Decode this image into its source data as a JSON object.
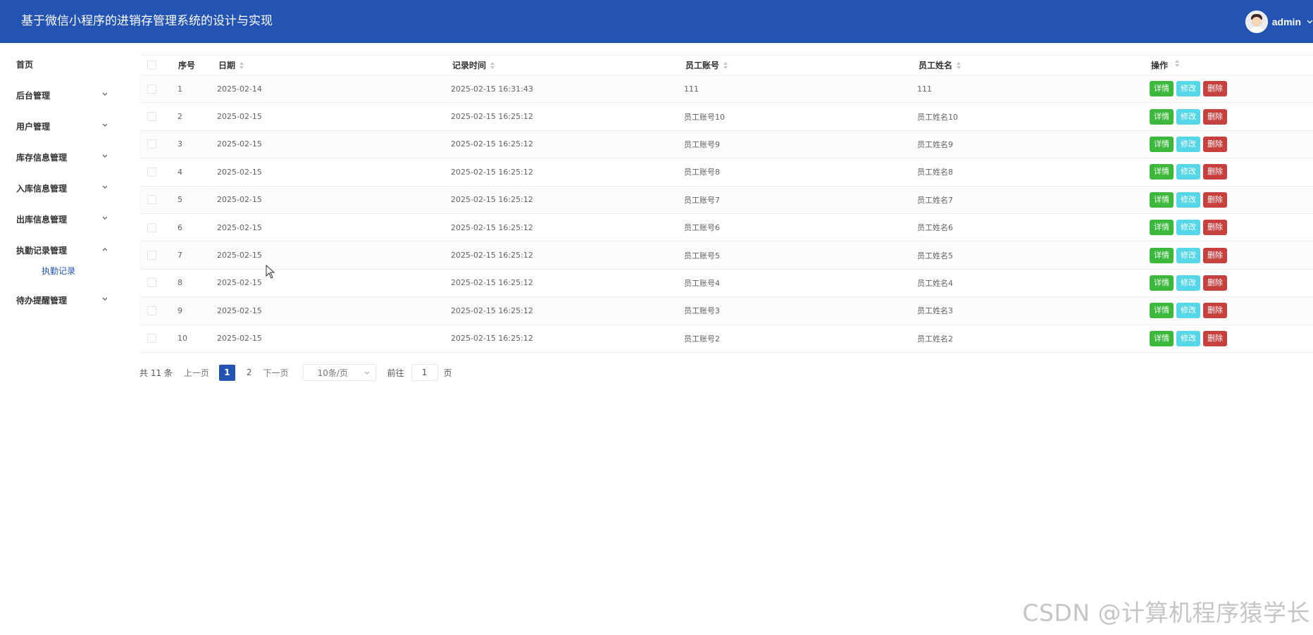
{
  "header": {
    "title": "基于微信小程序的进销存管理系统的设计与实现",
    "user": "admin",
    "accent": "#2354b4"
  },
  "sidebar": {
    "items": [
      {
        "label": "首页",
        "expandable": false
      },
      {
        "label": "后台管理",
        "expandable": true,
        "expanded": false
      },
      {
        "label": "用户管理",
        "expandable": true,
        "expanded": false
      },
      {
        "label": "库存信息管理",
        "expandable": true,
        "expanded": false
      },
      {
        "label": "入库信息管理",
        "expandable": true,
        "expanded": false
      },
      {
        "label": "出库信息管理",
        "expandable": true,
        "expanded": false
      },
      {
        "label": "执勤记录管理",
        "expandable": true,
        "expanded": true
      },
      {
        "label": "待办提醒管理",
        "expandable": true,
        "expanded": false
      }
    ],
    "active_sub": "执勤记录"
  },
  "table": {
    "headers": [
      "序号",
      "日期",
      "记录时间",
      "员工账号",
      "员工姓名",
      "操作"
    ],
    "rows": [
      {
        "idx": "1",
        "date": "2025-02-14",
        "time": "2025-02-15 16:31:43",
        "account": "111",
        "name": "111"
      },
      {
        "idx": "2",
        "date": "2025-02-15",
        "time": "2025-02-15 16:25:12",
        "account": "员工账号10",
        "name": "员工姓名10"
      },
      {
        "idx": "3",
        "date": "2025-02-15",
        "time": "2025-02-15 16:25:12",
        "account": "员工账号9",
        "name": "员工姓名9"
      },
      {
        "idx": "4",
        "date": "2025-02-15",
        "time": "2025-02-15 16:25:12",
        "account": "员工账号8",
        "name": "员工姓名8"
      },
      {
        "idx": "5",
        "date": "2025-02-15",
        "time": "2025-02-15 16:25:12",
        "account": "员工账号7",
        "name": "员工姓名7"
      },
      {
        "idx": "6",
        "date": "2025-02-15",
        "time": "2025-02-15 16:25:12",
        "account": "员工账号6",
        "name": "员工姓名6"
      },
      {
        "idx": "7",
        "date": "2025-02-15",
        "time": "2025-02-15 16:25:12",
        "account": "员工账号5",
        "name": "员工姓名5"
      },
      {
        "idx": "8",
        "date": "2025-02-15",
        "time": "2025-02-15 16:25:12",
        "account": "员工账号4",
        "name": "员工姓名4"
      },
      {
        "idx": "9",
        "date": "2025-02-15",
        "time": "2025-02-15 16:25:12",
        "account": "员工账号3",
        "name": "员工姓名3"
      },
      {
        "idx": "10",
        "date": "2025-02-15",
        "time": "2025-02-15 16:25:12",
        "account": "员工账号2",
        "name": "员工姓名2"
      }
    ],
    "actions": {
      "detail": "详情",
      "edit": "修改",
      "delete": "删除"
    },
    "action_colors": {
      "detail": "#3cb93c",
      "edit": "#56d7e8",
      "delete": "#c8403e"
    }
  },
  "pager": {
    "total": "共 11 条",
    "prev": "上一页",
    "pages": [
      "1",
      "2"
    ],
    "current": "1",
    "next": "下一页",
    "page_size": "10条/页",
    "goto_label": "前往",
    "goto_value": "1",
    "page_unit": "页"
  },
  "watermark": "CSDN @计算机程序猿学长"
}
